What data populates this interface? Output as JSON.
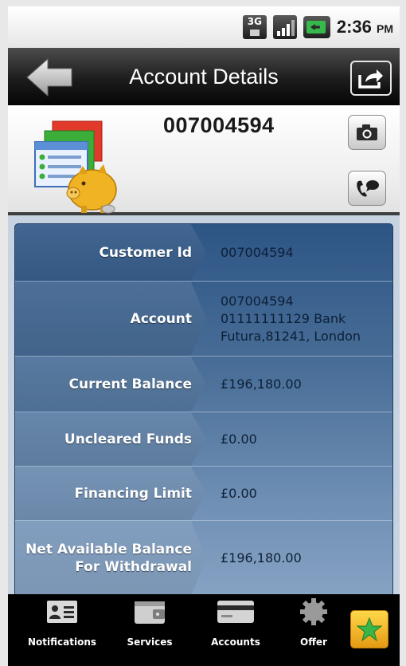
{
  "status_bar": {
    "network": "3G",
    "time": "2:36",
    "ampm": "PM"
  },
  "title_bar": {
    "title": "Account Details",
    "back_icon": "back-arrow-icon",
    "share_icon": "share-icon"
  },
  "header": {
    "account_number": "007004594",
    "account_icon": "account-piggy-bank-icon",
    "camera_icon": "camera-icon",
    "call_icon": "call-bubble-icon"
  },
  "details": [
    {
      "label": "Customer Id",
      "value": "007004594"
    },
    {
      "label": "Account",
      "value_lines": [
        "007004594",
        "01111111129 Bank",
        "Futura,81241, London"
      ]
    },
    {
      "label": "Current Balance",
      "value": "£196,180.00"
    },
    {
      "label": "Uncleared Funds",
      "value": "£0.00"
    },
    {
      "label": "Financing Limit",
      "value": "£0.00"
    },
    {
      "label": "Net Available Balance For Withdrawal",
      "value": "£196,180.00"
    }
  ],
  "bottom_nav": {
    "items": [
      {
        "label": "Notifications",
        "icon": "contact-card-icon"
      },
      {
        "label": "Services",
        "icon": "wallet-icon"
      },
      {
        "label": "Accounts",
        "icon": "credit-card-icon"
      },
      {
        "label": "Offer",
        "icon": "gear-icon"
      }
    ],
    "favorite_icon": "star-icon"
  },
  "colors": {
    "panel_top": "#2d5585",
    "panel_bottom": "#86a2c3",
    "title_bar": "#1c1c1c",
    "favorite": "#f5b820",
    "favorite_star": "#3bb54a"
  }
}
